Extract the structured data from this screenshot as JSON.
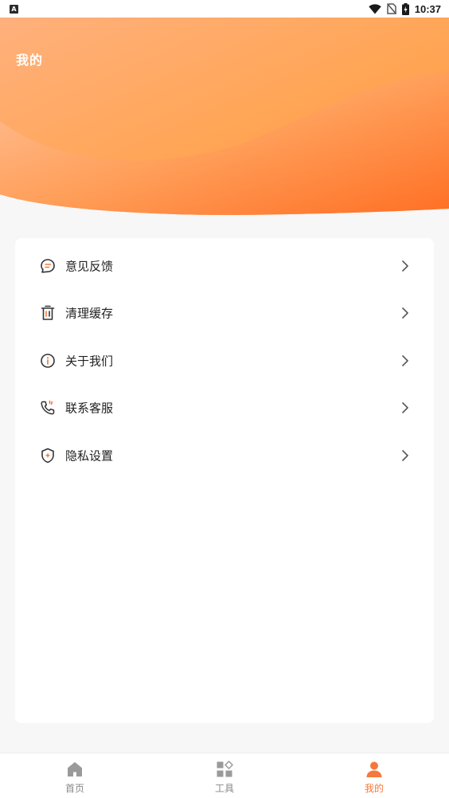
{
  "status_bar": {
    "badge": "A",
    "time": "10:37",
    "icons": [
      "wifi-icon",
      "no-sim-icon",
      "battery-charging-icon"
    ]
  },
  "header": {
    "title": "我的",
    "gradient_colors": [
      "#ffb07c",
      "#ff9a3d",
      "#ff7a2a"
    ]
  },
  "menu": {
    "items": [
      {
        "label": "意见反馈",
        "icon": "feedback-icon"
      },
      {
        "label": "清理缓存",
        "icon": "trash-icon"
      },
      {
        "label": "关于我们",
        "icon": "info-icon"
      },
      {
        "label": "联系客服",
        "icon": "phone-icon"
      },
      {
        "label": "隐私设置",
        "icon": "shield-icon"
      }
    ]
  },
  "bottom_nav": {
    "items": [
      {
        "label": "首页",
        "icon": "home-icon",
        "active": false
      },
      {
        "label": "工具",
        "icon": "tools-icon",
        "active": false
      },
      {
        "label": "我的",
        "icon": "user-icon",
        "active": true
      }
    ]
  },
  "colors": {
    "accent": "#f5793b",
    "inactive": "#888888",
    "icon_stroke": "#333333"
  }
}
